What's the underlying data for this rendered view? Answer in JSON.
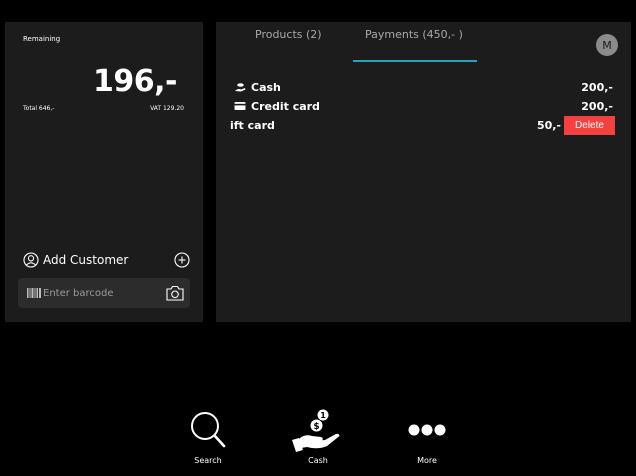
{
  "summary": {
    "remaining_label": "Remaining",
    "remaining_amount": "196,-",
    "total_label": "Total 646,-",
    "vat_label": "VAT 129.20"
  },
  "customer": {
    "add_label": "Add Customer"
  },
  "barcode": {
    "placeholder": "Enter barcode",
    "value": ""
  },
  "tabs": [
    {
      "label": "Products (2)",
      "active": false
    },
    {
      "label": "Payments (450,- )",
      "active": true
    }
  ],
  "avatar": {
    "initial": "M"
  },
  "payments": [
    {
      "name": "Cash",
      "icon": "cash-icon",
      "amount": "200,-"
    },
    {
      "name": "Credit card",
      "icon": "credit-card-icon",
      "amount": "200,-"
    },
    {
      "name": "ift card",
      "icon": "",
      "amount": "50,-",
      "action": "Delete"
    }
  ],
  "bottom_nav": [
    {
      "label": "Search",
      "icon": "search-icon"
    },
    {
      "label": "Cash",
      "icon": "cash-hand-icon"
    },
    {
      "label": "More",
      "icon": "more-icon"
    }
  ],
  "colors": {
    "accent": "#27a3b5",
    "delete": "#f2413f",
    "panel": "#1c1c1c",
    "background": "#000000"
  }
}
